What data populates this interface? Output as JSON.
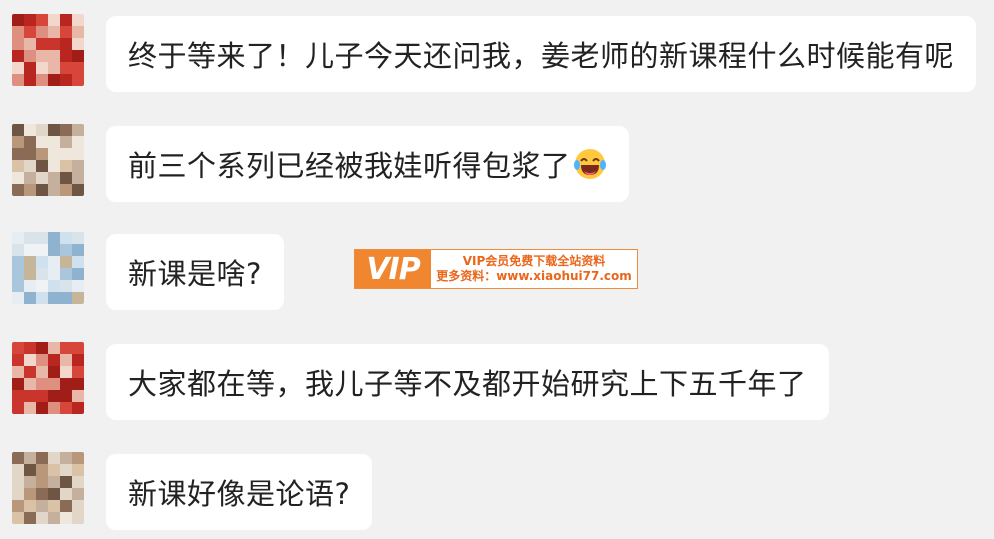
{
  "messages": [
    {
      "text": "终于等来了！儿子今天还问我，姜老师的新课程什么时候能有呢",
      "avatar": "red-blurred-avatar"
    },
    {
      "text": "前三个系列已经被我娃听得包浆了",
      "emoji": "laughing-crying-emoji",
      "avatar": "brown-blurred-avatar"
    },
    {
      "text": "新课是啥?",
      "avatar": "sky-blurred-avatar"
    },
    {
      "text": "大家都在等，我儿子等不及都开始研究上下五千年了",
      "avatar": "red-blurred-avatar"
    },
    {
      "text": "新课好像是论语?",
      "avatar": "brown-blurred-avatar"
    }
  ],
  "watermark": {
    "logo": "VIP",
    "line1": "VIP会员免费下载全站资料",
    "line2": "更多资料：www.xiaohui77.com"
  },
  "colors": {
    "background": "#f1f1f1",
    "bubble": "#ffffff",
    "text": "#222222",
    "watermark_accent": "#f0862f"
  }
}
